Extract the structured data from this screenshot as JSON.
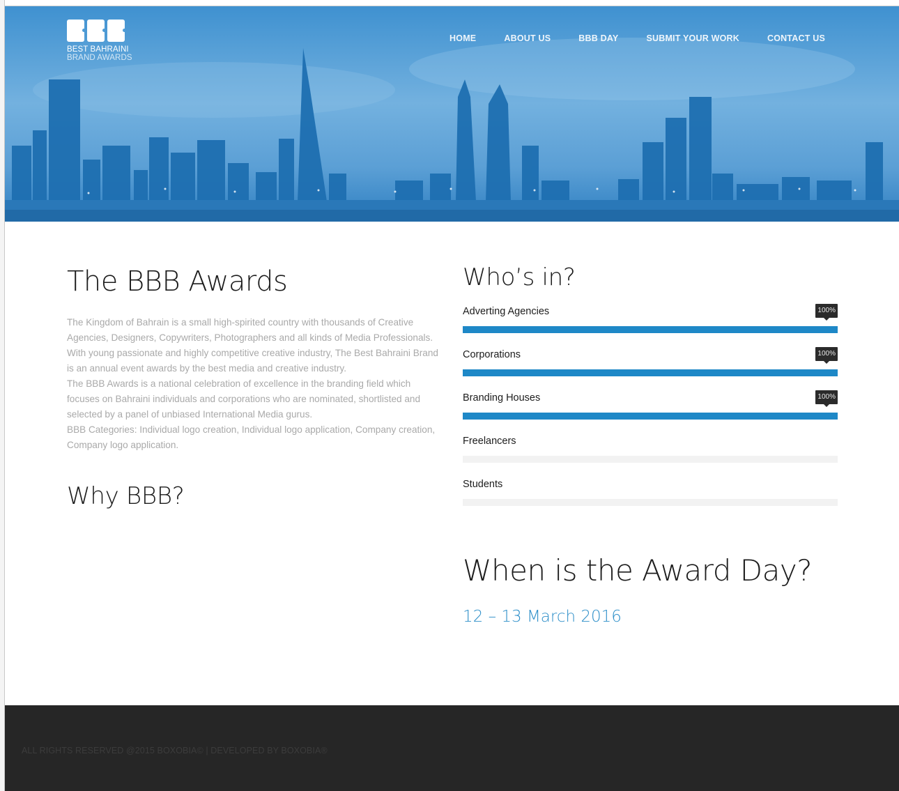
{
  "brand": {
    "line1": "BEST BAHRAINI",
    "line2": "BRAND AWARDS"
  },
  "nav": [
    {
      "label": "HOME"
    },
    {
      "label": "ABOUT US"
    },
    {
      "label": "BBB DAY"
    },
    {
      "label": "SUBMIT YOUR WORK"
    },
    {
      "label": "CONTACT US"
    }
  ],
  "about": {
    "title": "The BBB Awards",
    "paragraph_1": "The Kingdom of Bahrain is a small high-spirited country with thousands of Creative Agencies, Designers, Copywriters, Photographers and all kinds of Media Professionals. With young passionate and highly competitive creative industry, The Best Bahraini Brand is an annual event awards by the best media and creative industry.",
    "paragraph_2": "The BBB Awards is a national celebration of excellence in the branding field which focuses on Bahraini individuals and corporations who are nominated, shortlisted and selected by a panel of unbiased International Media gurus.",
    "paragraph_3": "BBB Categories: Individual logo creation, Individual logo application, Company creation, Company logo application.",
    "why_title": "Why BBB?"
  },
  "whos_in": {
    "title": "Who’s in?",
    "items": [
      {
        "label": "Adverting Agencies",
        "percent": 100,
        "percent_label": "100%"
      },
      {
        "label": "Corporations",
        "percent": 100,
        "percent_label": "100%"
      },
      {
        "label": "Branding Houses",
        "percent": 100,
        "percent_label": "100%"
      },
      {
        "label": "Freelancers",
        "percent": 0,
        "percent_label": ""
      },
      {
        "label": "Students",
        "percent": 0,
        "percent_label": ""
      }
    ]
  },
  "award_day": {
    "title": "When is the Award Day?",
    "date": "12 – 13 March 2016"
  },
  "footer": {
    "text": "ALL RIGHTS RESERVED @2015 BOXOBIA© | DEVELOPED BY BOXOBIA®"
  },
  "colors": {
    "accent": "#1e88c7",
    "hero_blue": "#3b8fcf",
    "footer_bg": "#262626",
    "tooltip_bg": "#2b2b2b"
  }
}
